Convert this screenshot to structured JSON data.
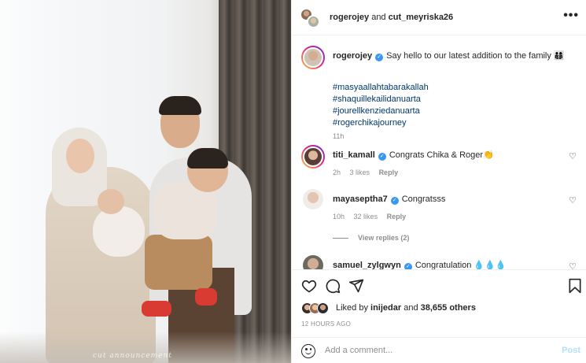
{
  "photo": {
    "watermark": "cut announcement"
  },
  "header": {
    "user1": "rogerojey",
    "connector": " and ",
    "user2": "cut_meyriska26",
    "more_icon": "more-horizontal-icon"
  },
  "caption": {
    "username": "rogerojey",
    "text": "Say hello to our latest addition to the family 👨‍👩‍👦‍👦",
    "hashtags": [
      "#masyaallahtabarakallah",
      "#shaquillekailidanuarta",
      "#jourellkenziedanuarta",
      "#rogerchikajourney"
    ],
    "time": "11h"
  },
  "comments": [
    {
      "username": "titi_kamall",
      "text": "Congrats Chika & Roger👏",
      "time": "2h",
      "likes": "3 likes",
      "reply": "Reply"
    },
    {
      "username": "mayaseptha7",
      "text": "Congratsss",
      "time": "10h",
      "likes": "32 likes",
      "reply": "Reply",
      "view_replies": "View replies (2)"
    },
    {
      "username": "samuel_zylgwyn",
      "text": "Congratulation 💧💧💧"
    }
  ],
  "likes": {
    "prefix": "Liked by ",
    "user": "inijedar",
    "middle": " and ",
    "count": "38,655 others"
  },
  "timestamp": "12 HOURS AGO",
  "add_comment": {
    "placeholder": "Add a comment...",
    "post": "Post"
  },
  "colors": {
    "link": "#00376b",
    "verified": "#3897f0",
    "post_disabled": "#b2dffc",
    "muted": "#8e8e8e"
  }
}
